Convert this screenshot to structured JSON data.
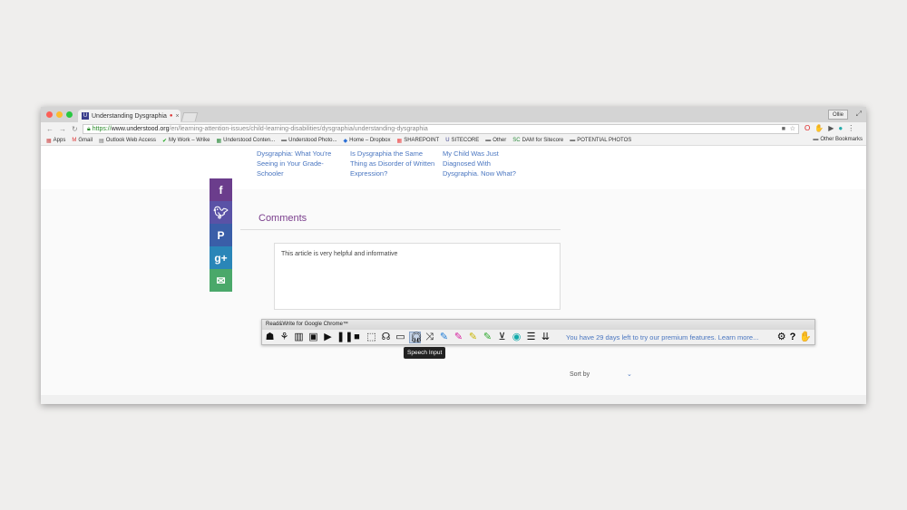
{
  "browser": {
    "tab_title": "Understanding Dysgraphia",
    "profile": "Ollie",
    "url_scheme": "https://",
    "url_domain": "www.understood.org",
    "url_path": "/en/learning-attention-issues/child-learning-disabilities/dysgraphia/understanding-dysgraphia"
  },
  "bookmarks": [
    {
      "icon": "apps-icon",
      "label": "Apps"
    },
    {
      "icon": "gmail-icon",
      "label": "Gmail"
    },
    {
      "icon": "outlook-icon",
      "label": "Outlook Web Access"
    },
    {
      "icon": "wrike-icon",
      "label": "My Work – Wrike"
    },
    {
      "icon": "sheet-icon",
      "label": "Understood Conten..."
    },
    {
      "icon": "folder-icon",
      "label": "Understood Photo..."
    },
    {
      "icon": "dropbox-icon",
      "label": "Home – Dropbox"
    },
    {
      "icon": "sharepoint-icon",
      "label": "SHAREPOINT"
    },
    {
      "icon": "sitecore-icon",
      "label": "SITECORE"
    },
    {
      "icon": "folder-icon",
      "label": "Other"
    },
    {
      "icon": "sitecore-dam-icon",
      "label": "DAM for Sitecore"
    },
    {
      "icon": "folder-icon",
      "label": "POTENTIAL PHOTOS"
    }
  ],
  "other_bookmarks": "Other Bookmarks",
  "related_links": [
    "Dysgraphia: What You're Seeing in Your Grade-Schooler",
    "Is Dysgraphia the Same Thing as Disorder of Written Expression?",
    "My Child Was Just Diagnosed With Dysgraphia. Now What?"
  ],
  "social": [
    "f",
    "t",
    "P",
    "g+",
    "✉"
  ],
  "comments": {
    "title": "Comments",
    "text": "This article is very helpful and informative"
  },
  "readwrite": {
    "title": "Read&Write for Google Chrome™",
    "trial": "You have 29 days left to try our premium features. Learn more...",
    "tooltip": "Speech Input"
  },
  "sort_label": "Sort by",
  "colors": {
    "purple": "#7a3e8c",
    "link": "#4a76c0"
  }
}
